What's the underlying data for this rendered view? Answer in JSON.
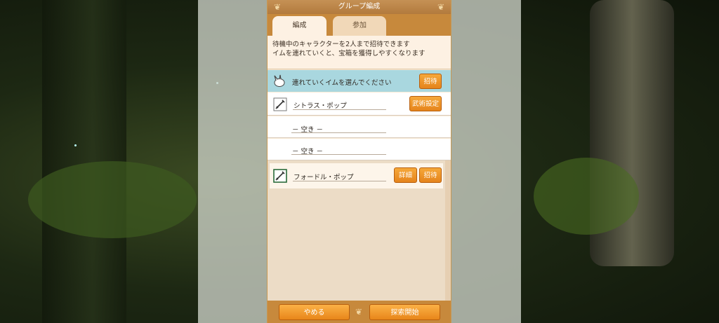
{
  "title": "グループ編成",
  "tabs": [
    {
      "label": "編成",
      "active": true
    },
    {
      "label": "参加",
      "active": false
    }
  ],
  "info_lines": [
    "待機中のキャラクターを2人まで招待できます",
    "イムを連れていくと、宝箱を獲得しやすくなります"
  ],
  "select_prompt": {
    "text": "連れていくイムを選んでください",
    "button": "招待"
  },
  "party": [
    {
      "name": "シトラス・ポップ",
      "button": "武術設定"
    },
    {
      "name": "－ 空き －"
    },
    {
      "name": "－ 空き －"
    }
  ],
  "available": [
    {
      "name": "フォードル・ポップ",
      "detail_button": "詳細",
      "invite_button": "招待"
    }
  ],
  "footer": {
    "cancel": "やめる",
    "start": "探索開始"
  },
  "colors": {
    "accent": "#e8861a",
    "header": "#c7893c",
    "select_row": "#a9d7df",
    "panel": "#f8e9d4"
  },
  "icons": {
    "select_row": "hand-cursor-icon",
    "party_member": "sword-icon",
    "available_member": "sword-icon"
  }
}
